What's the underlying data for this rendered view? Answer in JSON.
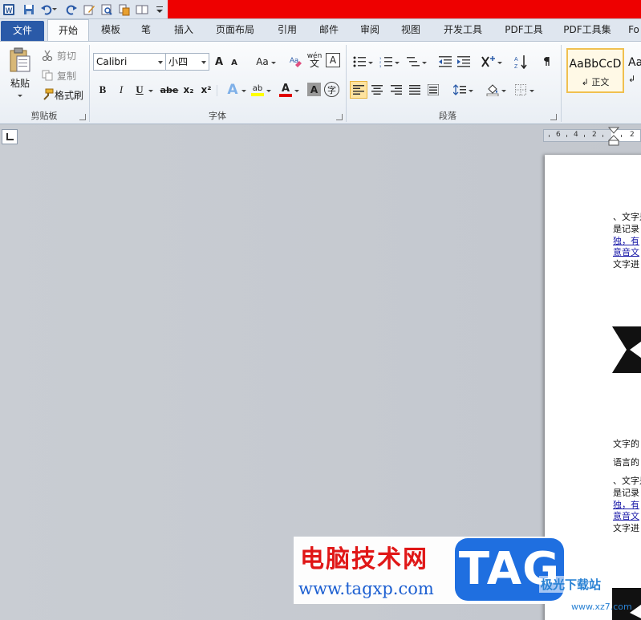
{
  "quick_access": {
    "app_icon": "word-icon",
    "icons": [
      "save-icon",
      "undo-icon",
      "redo-icon",
      "edit-icon",
      "print-preview-icon",
      "new-doc-icon",
      "read-mode-icon",
      "customize-icon"
    ]
  },
  "tabs": [
    {
      "label": "文件"
    },
    {
      "label": "开始"
    },
    {
      "label": "模板"
    },
    {
      "label": "笔"
    },
    {
      "label": "插入"
    },
    {
      "label": "页面布局"
    },
    {
      "label": "引用"
    },
    {
      "label": "邮件"
    },
    {
      "label": "审阅"
    },
    {
      "label": "视图"
    },
    {
      "label": "开发工具"
    },
    {
      "label": "PDF工具"
    },
    {
      "label": "PDF工具集"
    },
    {
      "label": "Fo"
    }
  ],
  "clipboard": {
    "paste": "粘贴",
    "cut": "剪切",
    "copy": "复制",
    "format_painter": "格式刷",
    "group": "剪贴板"
  },
  "font": {
    "name": "Calibri",
    "size": "小四",
    "group": "字体",
    "grow": "A",
    "shrink": "A",
    "change_case": "Aa",
    "bold": "B",
    "italic": "I",
    "underline": "U",
    "strike": "abe",
    "subscript": "x₂",
    "superscript": "x²",
    "phonetic": "wén",
    "char_border": "A",
    "text_effect": "A",
    "highlight": "ab",
    "font_color": "A",
    "char_shade": "A",
    "enclose": "字"
  },
  "paragraph": {
    "group": "段落"
  },
  "styles": {
    "normal_sample": "AaBbCcD",
    "normal_name": "正文",
    "second_sample": "Aa"
  },
  "ruler": {
    "numbers": [
      "6",
      "4",
      "2",
      "2"
    ]
  },
  "document": {
    "lines": [
      {
        "text": "、文字是",
        "link": false
      },
      {
        "text": "是记录",
        "link": false
      },
      {
        "text": "独，有",
        "link": true
      },
      {
        "text": "意音文",
        "link": true
      },
      {
        "text": "文字进",
        "link": false
      },
      {
        "text": "文字的",
        "link": false
      },
      {
        "text": "语言的",
        "link": false
      },
      {
        "text": "、文字是",
        "link": false
      },
      {
        "text": "是记录",
        "link": false
      },
      {
        "text": "独，有",
        "link": true
      },
      {
        "text": "意音文",
        "link": true
      },
      {
        "text": "文字进",
        "link": false
      }
    ]
  },
  "watermark": {
    "title": "电脑技术网",
    "url": "www.tagxp.com",
    "tag": "TAG",
    "site2": "极光下载站",
    "site2_url": "www.xz7.com"
  }
}
